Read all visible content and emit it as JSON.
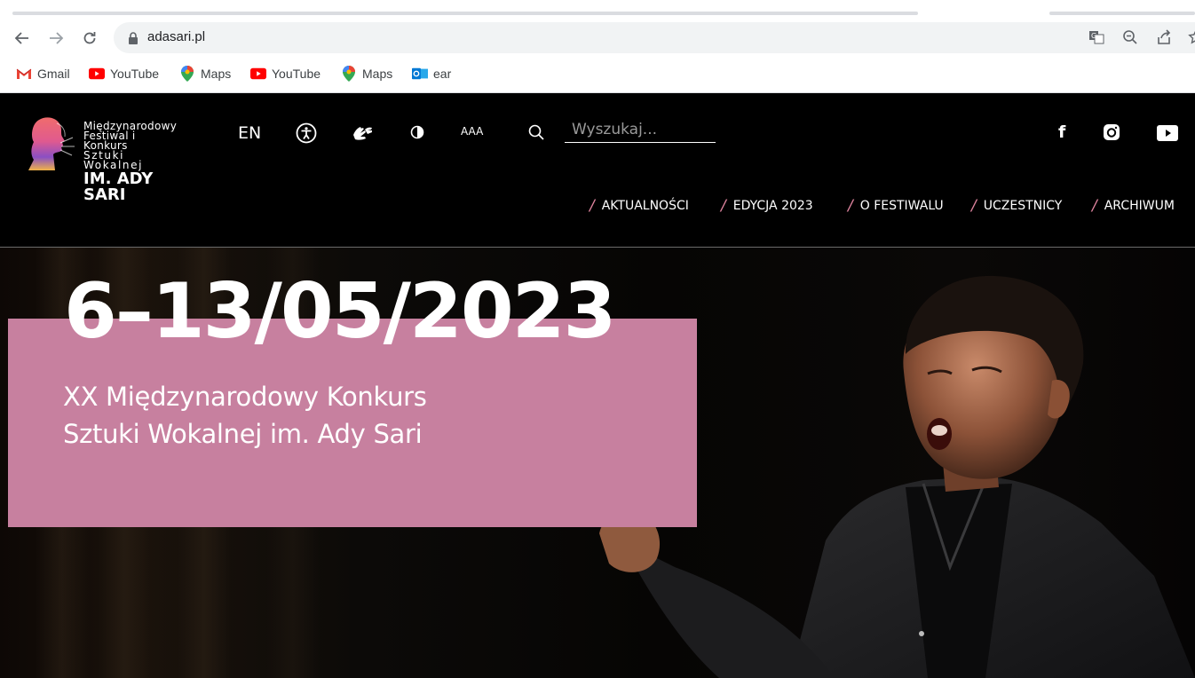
{
  "browser": {
    "url": "adasari.pl",
    "bookmarks": [
      {
        "label": "Gmail",
        "icon": "gmail-icon"
      },
      {
        "label": "YouTube",
        "icon": "youtube-icon"
      },
      {
        "label": "Maps",
        "icon": "maps-icon"
      },
      {
        "label": "YouTube",
        "icon": "youtube-icon"
      },
      {
        "label": "Maps",
        "icon": "maps-icon"
      },
      {
        "label": "ear",
        "icon": "outlook-icon"
      }
    ]
  },
  "site": {
    "logo": {
      "line1": "Międzynarodowy",
      "line2": "Festiwal i Konkurs",
      "line3": "Sztuki Wokalnej",
      "line4": "IM. ADY SARI"
    },
    "tools": {
      "language": "EN",
      "font_size": "AAA",
      "search_placeholder": "Wyszukaj..."
    },
    "social": {
      "facebook": "f"
    },
    "menu": [
      "AKTUALNOŚCI",
      "EDYCJA 2023",
      "O FESTIWALU",
      "UCZESTNICY",
      "ARCHIWUM"
    ],
    "hero": {
      "date": "6–13/05/2023",
      "subtitle_line1": "XX Międzynarodowy Konkurs",
      "subtitle_line2": "Sztuki Wokalnej im. Ady Sari"
    }
  },
  "colors": {
    "accent_pink": "#c7809f",
    "slash_pink": "#e0849f",
    "header_bg": "#000000"
  }
}
